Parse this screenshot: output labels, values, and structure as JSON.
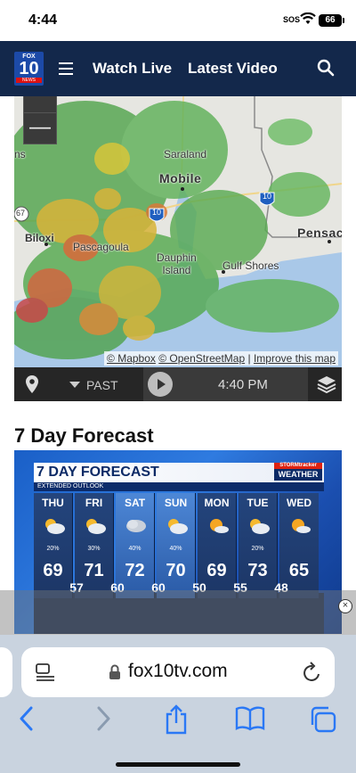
{
  "status_bar": {
    "time": "4:44",
    "sos": "SOS",
    "battery": "66"
  },
  "header": {
    "logo": {
      "top": "FOX",
      "number": "10",
      "bottom": "NEWS"
    },
    "nav_links": [
      "Watch Live",
      "Latest Video"
    ]
  },
  "map": {
    "labels": {
      "saraland": "Saraland",
      "mobile": "Mobile",
      "biloxi": "Biloxi",
      "pascagoula": "Pascagoula",
      "dauphin_island": "Dauphin\nIsland",
      "gulf_shores": "Gulf Shores",
      "pensacola": "Pensac",
      "edge_left": "ns",
      "i10_a": "10",
      "i10_b": "10",
      "hwy67": "67"
    },
    "zoom_out": "—",
    "attribution": {
      "mapbox": "© Mapbox",
      "osm": "© OpenStreetMap",
      "separator": "|",
      "improve": "Improve this map"
    },
    "controls": {
      "mode": "PAST",
      "time": "4:40 PM"
    }
  },
  "section": {
    "title": "7 Day Forecast"
  },
  "forecast_graphic": {
    "title": "7 DAY FORECAST",
    "subtitle": "EXTENDED OUTLOOK",
    "brand_top": "STORMtracker",
    "brand_bottom": "WEATHER",
    "days": [
      {
        "name": "THU",
        "pct": "20%",
        "high": "69"
      },
      {
        "name": "FRI",
        "pct": "30%",
        "high": "71"
      },
      {
        "name": "SAT",
        "pct": "40%",
        "high": "72"
      },
      {
        "name": "SUN",
        "pct": "40%",
        "high": "70"
      },
      {
        "name": "MON",
        "pct": "",
        "high": "69"
      },
      {
        "name": "TUE",
        "pct": "20%",
        "high": "73"
      },
      {
        "name": "WED",
        "pct": "",
        "high": "65"
      }
    ],
    "lows": [
      "57",
      "60",
      "60",
      "50",
      "55",
      "48"
    ]
  },
  "ad": {
    "close": "×"
  },
  "browser": {
    "domain": "fox10tv.com"
  }
}
